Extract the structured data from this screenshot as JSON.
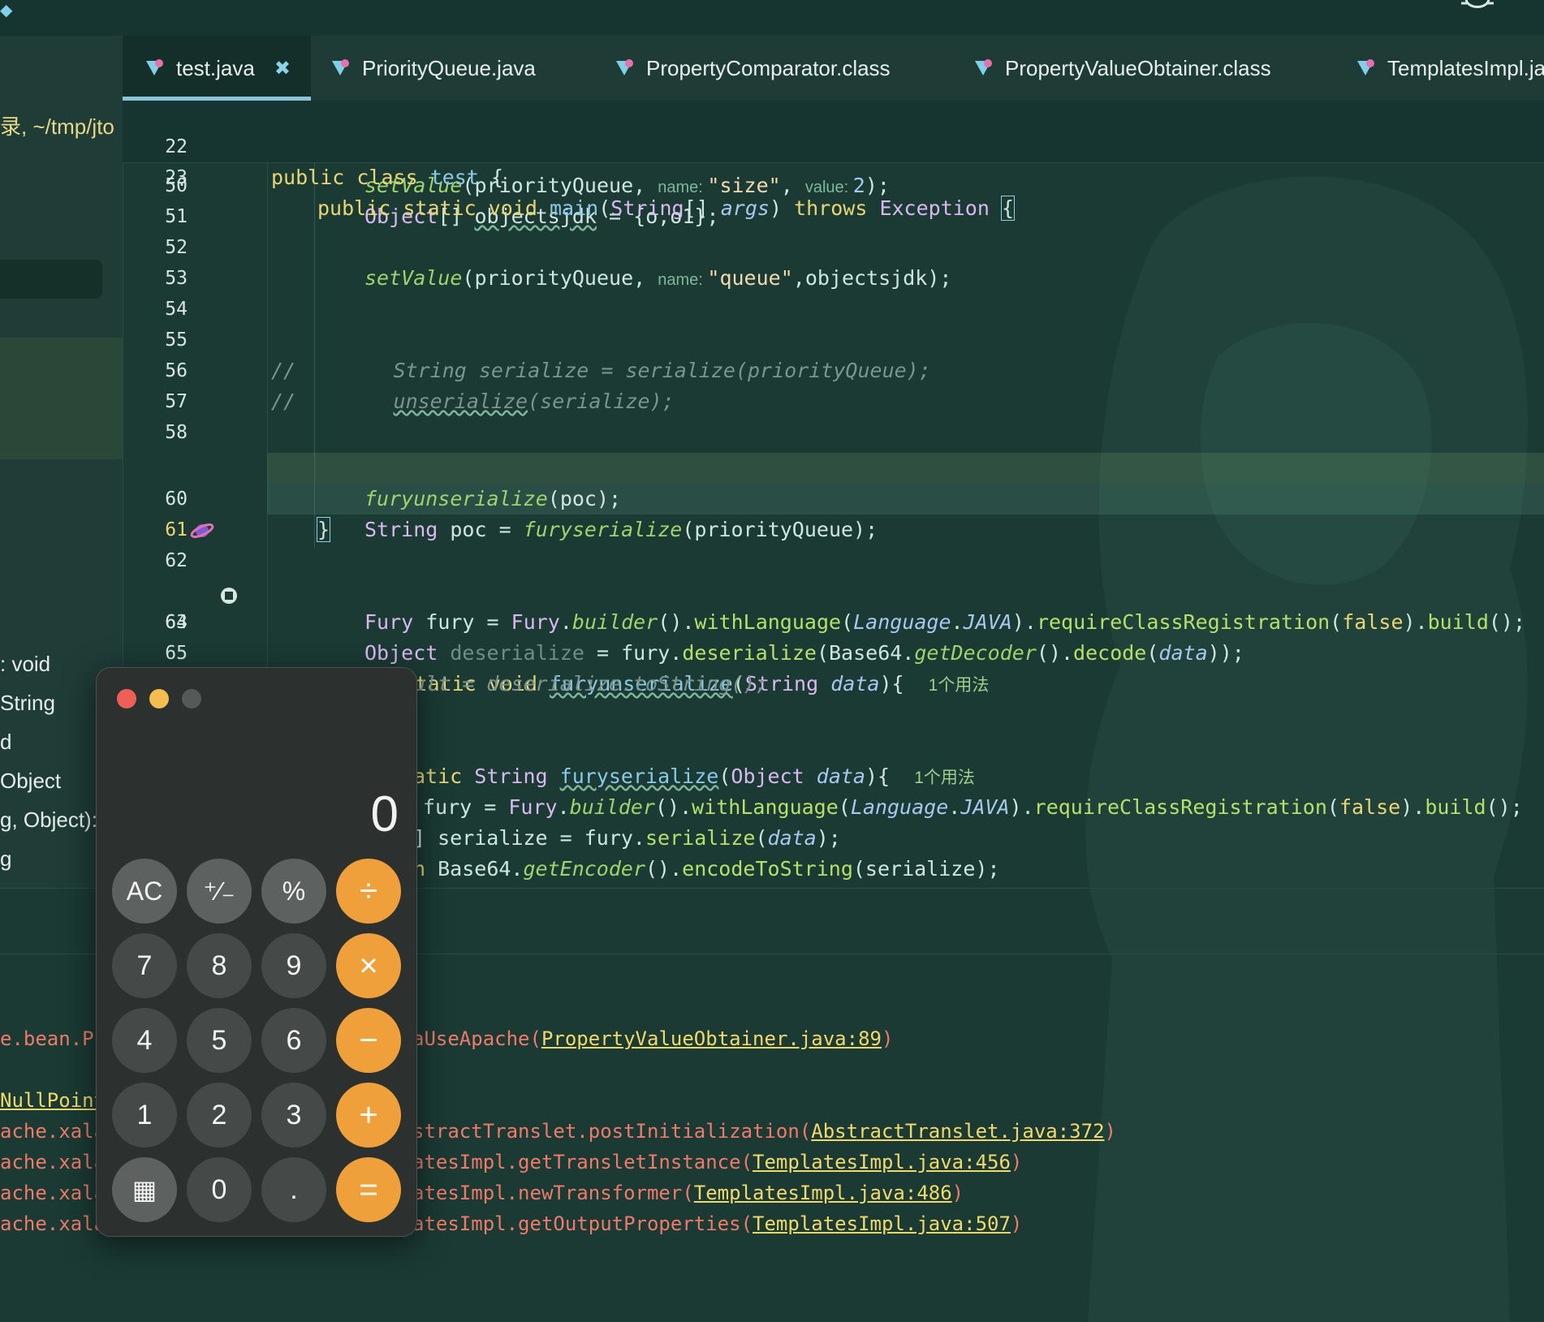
{
  "tabs": [
    {
      "label": "test.java",
      "close": "✖"
    },
    {
      "label": "PriorityQueue.java"
    },
    {
      "label": "PropertyComparator.class"
    },
    {
      "label": "PropertyValueObtainer.class"
    },
    {
      "label": "TemplatesImpl.ja"
    }
  ],
  "left_panel": {
    "path": "录, ~/tmp/jto",
    "members": [
      ": void",
      "String",
      "d",
      "Object",
      "g, Object):",
      "g"
    ]
  },
  "editor": {
    "sticky": [
      {
        "ln": "22"
      },
      {
        "ln": "23"
      }
    ],
    "lines": {
      "l50": "50",
      "l51": "51",
      "l52": "52",
      "l53": "53",
      "l54": "54",
      "l55": "55",
      "l56": "56",
      "l57": "57",
      "l58": "58",
      "l60": "60",
      "l61": "61",
      "l62": "62",
      "l63": "63",
      "l64": "64",
      "l65": "65"
    },
    "usage_hint": "1个用法"
  },
  "console": {
    "lines": [
      {
        "prefix": "e.bean.P",
        "text": "aUseApache(",
        "link": "PropertyValueObtainer.java:89",
        "suffix": ")"
      },
      {
        "prefix": "NullPoint",
        "text": "",
        "link": "",
        "suffix": ""
      },
      {
        "prefix": "ache.xala",
        "text": "stractTranslet.postInitialization(",
        "link": "AbstractTranslet.java:372",
        "suffix": ")"
      },
      {
        "prefix": "ache.xala",
        "text": "atesImpl.getTransletInstance(",
        "link": "TemplatesImpl.java:456",
        "suffix": ")"
      },
      {
        "prefix": "ache.xala",
        "text": "atesImpl.newTransformer(",
        "link": "TemplatesImpl.java:486",
        "suffix": ")"
      },
      {
        "prefix": "ache.xala",
        "text": "atesImpl.getOutputProperties(",
        "link": "TemplatesImpl.java:507",
        "suffix": ")"
      }
    ]
  },
  "calculator": {
    "display": "0",
    "keys": [
      [
        "AC",
        "⁺∕₋",
        "%",
        "÷"
      ],
      [
        "7",
        "8",
        "9",
        "×"
      ],
      [
        "4",
        "5",
        "6",
        "−"
      ],
      [
        "1",
        "2",
        "3",
        "+"
      ],
      [
        "▦",
        "0",
        ".",
        "="
      ]
    ]
  },
  "colors": {
    "background": "#1b3a34",
    "accent": "#f0a03a",
    "keyword": "#e8d676",
    "error": "#f07a6a"
  }
}
